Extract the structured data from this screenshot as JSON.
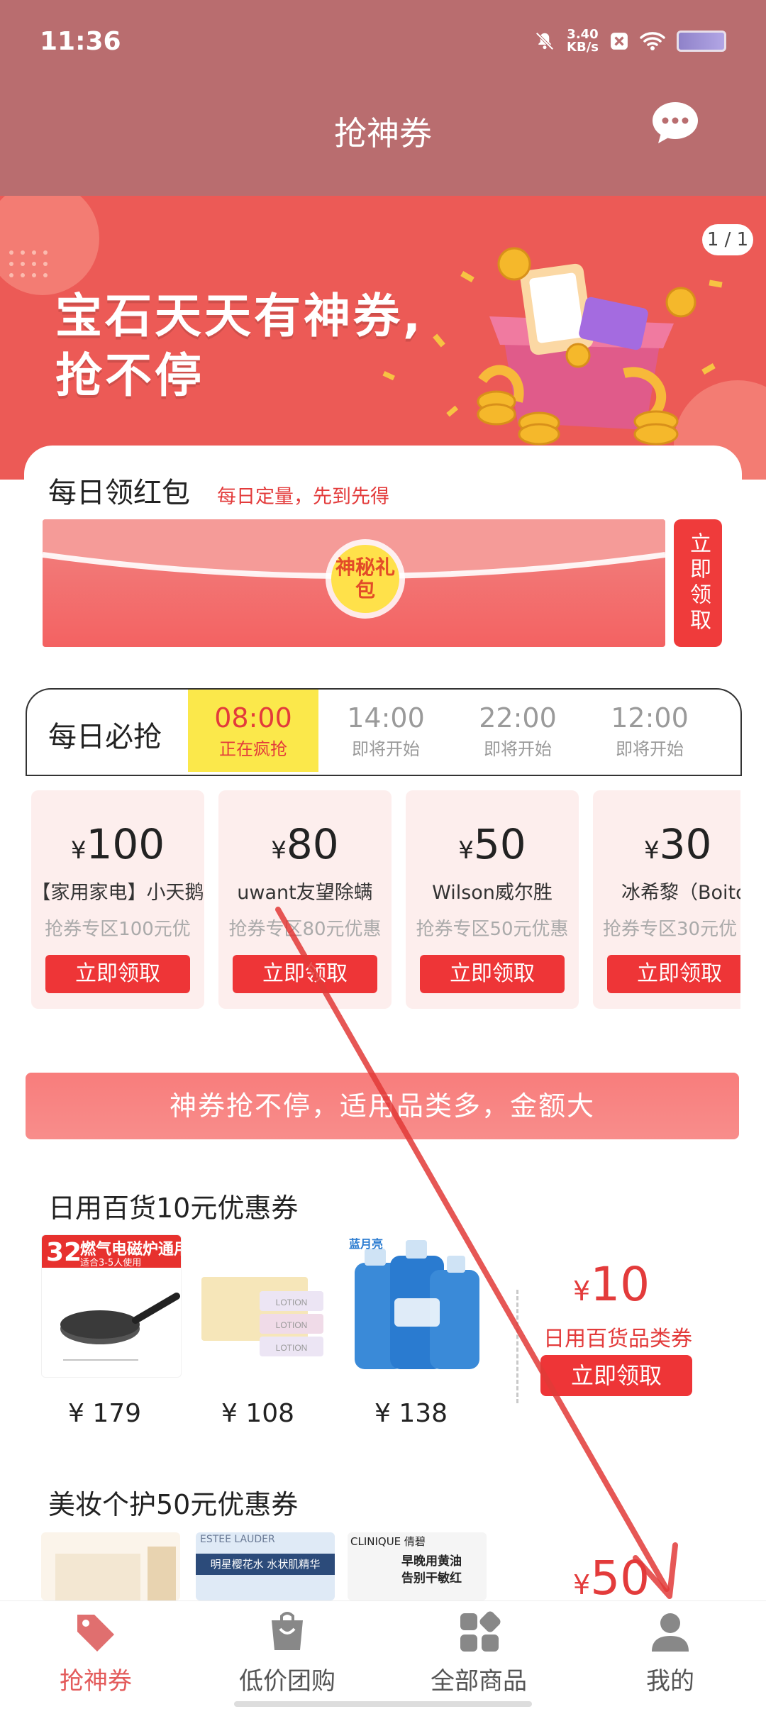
{
  "status": {
    "time": "11:36",
    "speed_value": "3.40",
    "speed_unit": "KB/s"
  },
  "header": {
    "title": "抢神券"
  },
  "banner": {
    "line1": "宝石天天有神券,",
    "line2": "抢不停",
    "pager": "1 / 1"
  },
  "red_packet": {
    "title": "每日领红包",
    "subtitle": "每日定量，先到先得",
    "badge": "神秘礼包",
    "claim": "立即领取"
  },
  "flash": {
    "title": "每日必抢",
    "tabs": [
      {
        "time": "08:00",
        "status": "正在疯抢"
      },
      {
        "time": "14:00",
        "status": "即将开始"
      },
      {
        "time": "22:00",
        "status": "即将开始"
      },
      {
        "time": "12:00",
        "status": "即将开始"
      }
    ]
  },
  "coupons": [
    {
      "currency": "¥",
      "amount": "100",
      "name": "【家用家电】小天鹅",
      "desc": "抢券专区100元优",
      "button": "立即领取"
    },
    {
      "currency": "¥",
      "amount": "80",
      "name": "uwant友望除螨",
      "desc": "抢券专区80元优惠",
      "button": "立即领取"
    },
    {
      "currency": "¥",
      "amount": "50",
      "name": "Wilson威尔胜",
      "desc": "抢券专区50元优惠",
      "button": "立即领取"
    },
    {
      "currency": "¥",
      "amount": "30",
      "name": "冰希黎（Boito",
      "desc": "抢券专区30元优",
      "button": "立即领取"
    }
  ],
  "slogan": "神券抢不停，适用品类多，金额大",
  "section1": {
    "title": "日用百货10元优惠券",
    "prices": [
      "¥ 179",
      "¥ 108",
      "¥ 138"
    ],
    "p1_tag_num": "32",
    "p1_tag_text": "燃气电磁炉通用",
    "p1_tag_sub": "适合3-5人使用",
    "p3_brand": "蓝月亮",
    "coupon": {
      "currency": "¥",
      "amount": "10",
      "type": "日用百货品类券",
      "button": "立即领取"
    }
  },
  "section2": {
    "title": "美妆个护50元优惠券",
    "p2_brand": "ESTEE LAUDER",
    "p2_sub": "明星樱花水 水状肌精华",
    "p3_brand": "CLINIQUE 倩碧",
    "p3_sub": "早晚用黄油",
    "p3_sub2": "告别干敏红",
    "coupon": {
      "currency": "¥",
      "amount": "50"
    }
  },
  "nav": [
    {
      "label": "抢神券",
      "icon": "coupon-tag-icon"
    },
    {
      "label": "低价团购",
      "icon": "shopping-bag-icon"
    },
    {
      "label": "全部商品",
      "icon": "grid-icon"
    },
    {
      "label": "我的",
      "icon": "user-icon"
    }
  ],
  "colors": {
    "header": "#b96d6f",
    "banner": "#ec5a56",
    "accent": "#ee3537",
    "active_tab": "#fbe84b"
  }
}
